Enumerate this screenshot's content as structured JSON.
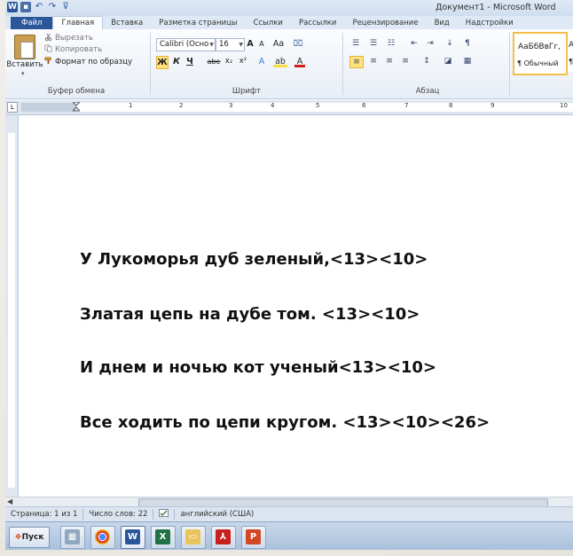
{
  "window": {
    "title": "Документ1 - Microsoft Word"
  },
  "tabs": [
    {
      "label": "Файл"
    },
    {
      "label": "Главная"
    },
    {
      "label": "Вставка"
    },
    {
      "label": "Разметка страницы"
    },
    {
      "label": "Ссылки"
    },
    {
      "label": "Рассылки"
    },
    {
      "label": "Рецензирование"
    },
    {
      "label": "Вид"
    },
    {
      "label": "Надстройки"
    }
  ],
  "ribbon": {
    "clipboard": {
      "paste": "Вставить",
      "cut": "Вырезать",
      "copy": "Копировать",
      "format_painter": "Формат по образцу",
      "group_label": "Буфер обмена"
    },
    "font": {
      "font_name": "Calibri (Осно",
      "font_size": "16",
      "group_label": "Шрифт",
      "bold": "Ж",
      "italic": "К",
      "underline": "Ч",
      "strike": "abe",
      "subscript": "x₂",
      "superscript": "x²",
      "grow": "A",
      "shrink": "A",
      "case": "Aa"
    },
    "paragraph": {
      "group_label": "Абзац",
      "show_marks": "¶"
    },
    "styles": {
      "sample": "АаБбВвГг,",
      "sample2": "Аа",
      "style_name": "¶ Обычный",
      "style_name2": "¶ Б"
    }
  },
  "ruler": {
    "numbers": [
      "1",
      "2",
      "3",
      "4",
      "5",
      "6",
      "7",
      "8",
      "9",
      "10"
    ]
  },
  "document": {
    "lines": [
      "У Лукоморья дуб зеленый,<13><10>",
      "Златая цепь на дубе том. <13><10>",
      "И днем и ночью кот ученый<13><10>",
      "Все ходить по цепи кругом. <13><10><26>"
    ]
  },
  "status": {
    "page": "Страница: 1 из 1",
    "words": "Число слов: 22",
    "language": "английский (США)"
  },
  "taskbar": {
    "start": "Пуск",
    "items": [
      "calculator-icon",
      "chrome-icon",
      "word-icon",
      "excel-icon",
      "explorer-icon",
      "acrobat-icon",
      "powerpoint-icon"
    ]
  },
  "colors": {
    "word_blue": "#2b579a",
    "highlight": "#ffe27a",
    "ribbon_bg": "#e8eef6"
  }
}
